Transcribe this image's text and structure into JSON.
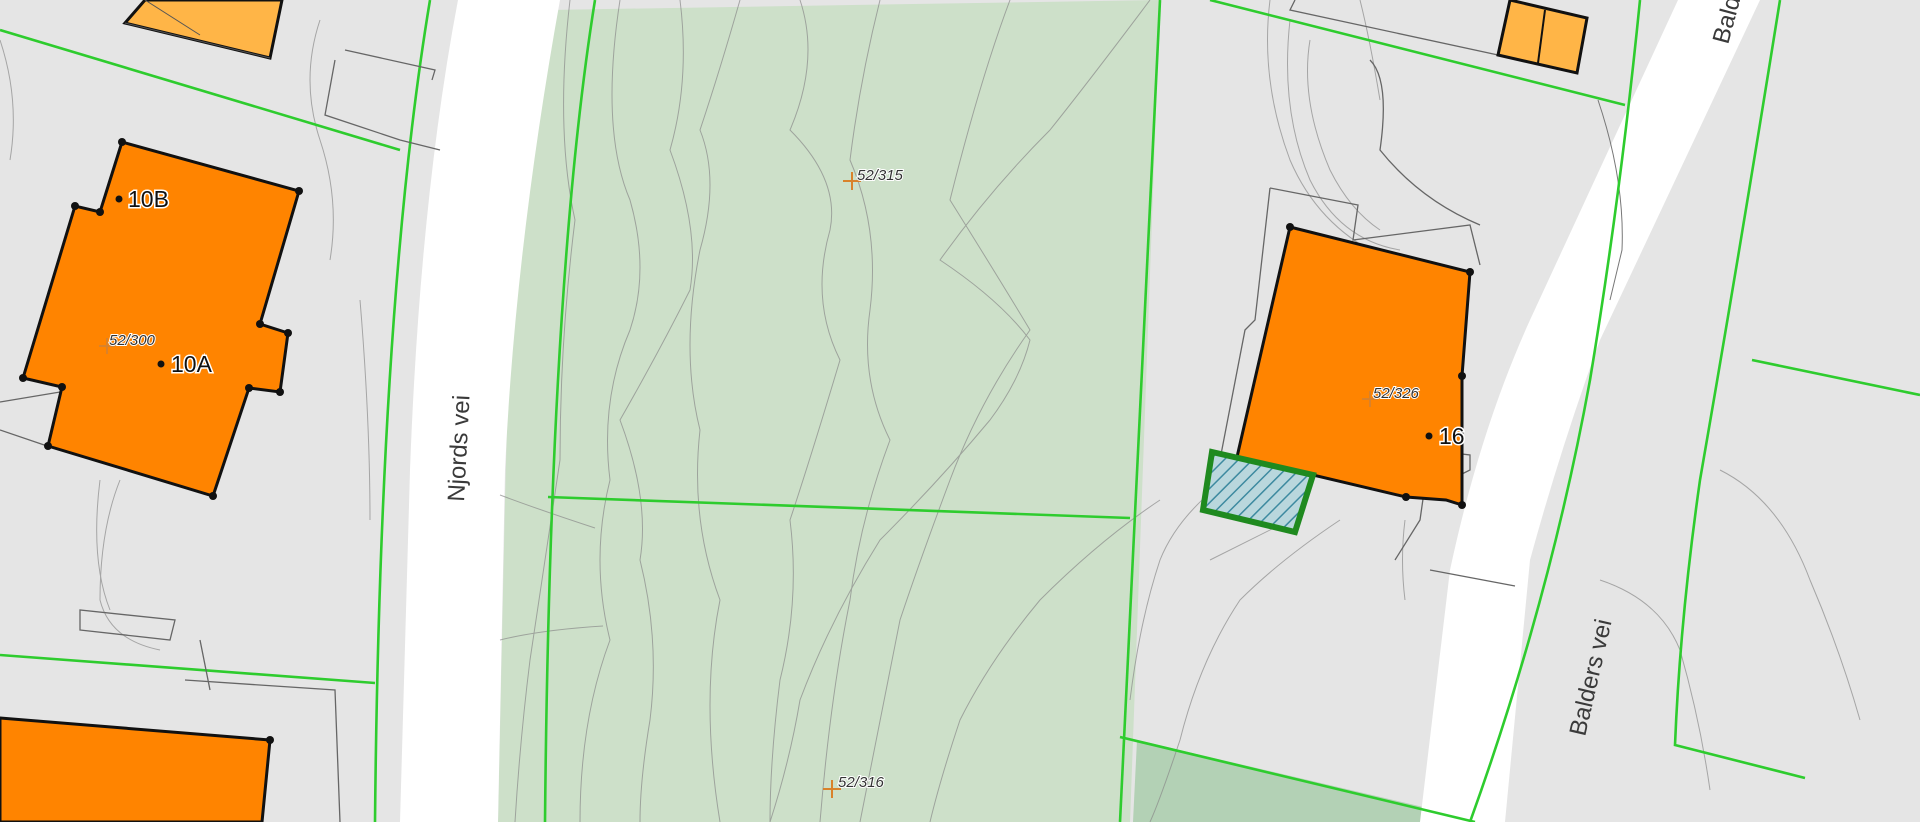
{
  "map": {
    "roads": [
      {
        "id": "njords",
        "name": "Njords vei"
      },
      {
        "id": "balders",
        "name": "Balders vei"
      },
      {
        "id": "balders_top",
        "name": "Bald"
      }
    ],
    "parcels": [
      {
        "id": "p315",
        "label": "52/315"
      },
      {
        "id": "p316",
        "label": "52/316"
      },
      {
        "id": "p300",
        "label": "52/300"
      },
      {
        "id": "p326",
        "label": "52/326"
      }
    ],
    "addresses": [
      {
        "id": "a10b",
        "label": "10B"
      },
      {
        "id": "a10a",
        "label": "10A"
      },
      {
        "id": "a16",
        "label": "16"
      }
    ],
    "colors": {
      "background": "#e5e5e5",
      "road": "#ffffff",
      "building": "#ff8400",
      "building_light": "#ffb547",
      "green_area": "#cde0c9",
      "property_line": "#2ecc2e",
      "contour": "#8a8a8a",
      "parcel_marker": "#d9822b",
      "highlight_feature": "#1f8a1f"
    }
  }
}
